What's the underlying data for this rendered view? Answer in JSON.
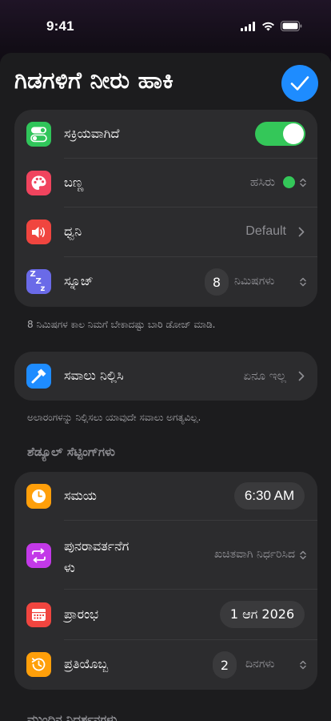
{
  "status": {
    "time": "9:41"
  },
  "title": "ಗಿಡಗಳಿಗೆ ನೀರು ಹಾಕಿ",
  "colors": {
    "accent": "#1e8cff",
    "toggle_on": "#34c759",
    "green_dot": "#34c759"
  },
  "alarm_card": {
    "enabled": {
      "label": "ಸಕ್ರಿಯವಾಗಿದೆ",
      "icon": "toggle-icon",
      "on": true
    },
    "color": {
      "label": "ಬಣ್ಣ",
      "icon": "palette-icon",
      "value": "ಹಸಿರು"
    },
    "sound": {
      "label": "ಧ್ವನಿ",
      "icon": "speaker-icon",
      "value": "Default"
    },
    "snooze": {
      "label": "ಸ್ನೂಜ್",
      "icon": "zzz-icon",
      "count": "8",
      "unit": "ನಿಮಿಷಗಳು"
    }
  },
  "snooze_footnote": "8 ನಿಮಿಷಗಳ ಕಾಲ ನಿಮಗೆ ಬೇಕಾದಷ್ಟು ಬಾರಿ ಡೋಜ್ ಮಾಡಿ.",
  "challenge_card": {
    "label": "ಸವಾಲು ನಿಲ್ಲಿಸಿ",
    "icon": "hammer-icon",
    "value": "ಏನೂ ಇಲ್ಲ"
  },
  "challenge_footnote": "ಅಲಾರಂಗಳನ್ನು ನಿಲ್ಲಿಸಲು ಯಾವುದೇ ಸವಾಲು ಅಗತ್ಯವಿಲ್ಲ.",
  "schedule_header": "ಶೆಡ್ಯೂಲ್ ಸೆಟ್ಟಿಂಗ್‌ಗಳು",
  "schedule_card": {
    "time": {
      "label": "ಸಮಯ",
      "icon": "clock-icon",
      "value": "6:30 AM"
    },
    "repeat": {
      "label_line1": "ಪುನರಾವರ್ತನೆಗ",
      "label_line2": "ಳು",
      "icon": "repeat-icon",
      "value": "ಖಚಿತವಾಗಿ ನಿರ್ಧರಿಸಿದ"
    },
    "start": {
      "label": "ಪ್ರಾರಂಭ",
      "icon": "calendar-icon",
      "value": "1 ಆಗ 2026"
    },
    "every": {
      "label": "ಪ್ರತಿಯೊಬ್ಬ",
      "icon": "history-icon",
      "count": "2",
      "unit": "ದಿನಗಳು"
    }
  },
  "next_header": "ಮುಂದಿನ ನಿದರ್ಶನಗಳು"
}
